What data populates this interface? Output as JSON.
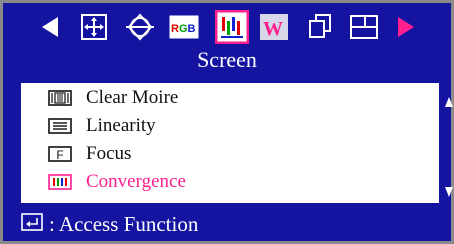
{
  "osd": {
    "title": "Screen",
    "toolbar": [
      {
        "icon": "left-arrow-icon"
      },
      {
        "icon": "position-icon"
      },
      {
        "icon": "geometry-icon"
      },
      {
        "icon": "rgb-color-icon",
        "text": "RGB"
      },
      {
        "icon": "screen-adjust-icon",
        "selected": true
      },
      {
        "icon": "advanced-icon"
      },
      {
        "icon": "copy-windows-icon"
      },
      {
        "icon": "window-layout-icon"
      },
      {
        "icon": "right-arrow-icon"
      }
    ],
    "menu": [
      {
        "label": "Clear Moire",
        "icon": "clear-moire-icon"
      },
      {
        "label": "Linearity",
        "icon": "linearity-icon"
      },
      {
        "label": "Focus",
        "icon": "focus-icon",
        "icon_text": "F"
      },
      {
        "label": "Convergence",
        "icon": "convergence-icon",
        "selected": true
      }
    ],
    "hint": ": Access Function",
    "colors": {
      "background": "#1414a0",
      "panel": "#ffffff",
      "selected_text": "#ff1f8f",
      "text_on_blue": "#ffffff"
    }
  }
}
